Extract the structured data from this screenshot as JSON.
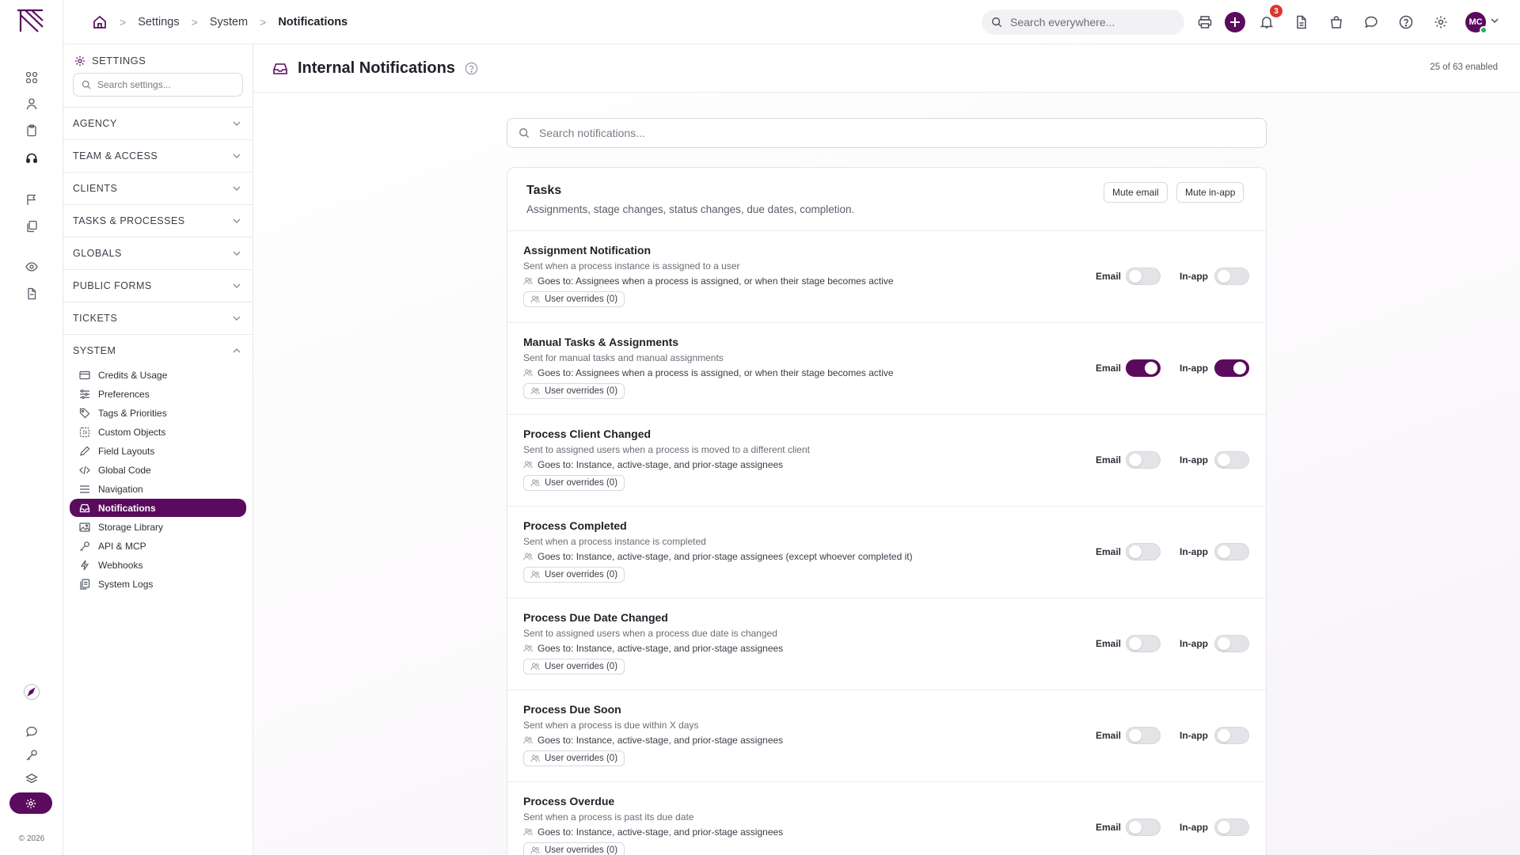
{
  "breadcrumb": {
    "items": [
      "Settings",
      "System"
    ],
    "current": "Notifications"
  },
  "global_search": {
    "placeholder": "Search everywhere..."
  },
  "notifications_badge": "3",
  "user": {
    "initials": "MC"
  },
  "footer": {
    "copyright": "© 2026"
  },
  "sidebar": {
    "heading": "SETTINGS",
    "search_placeholder": "Search settings...",
    "sections": [
      "AGENCY",
      "TEAM & ACCESS",
      "CLIENTS",
      "TASKS & PROCESSES",
      "GLOBALS",
      "PUBLIC FORMS",
      "TICKETS",
      "SYSTEM"
    ],
    "system_items": [
      {
        "label": "Credits & Usage",
        "icon": "card-icon"
      },
      {
        "label": "Preferences",
        "icon": "sliders-icon"
      },
      {
        "label": "Tags & Priorities",
        "icon": "tag-icon"
      },
      {
        "label": "Custom Objects",
        "icon": "objects-icon"
      },
      {
        "label": "Field Layouts",
        "icon": "pen-icon"
      },
      {
        "label": "Global Code",
        "icon": "code-icon"
      },
      {
        "label": "Navigation",
        "icon": "menu-icon"
      },
      {
        "label": "Notifications",
        "icon": "inbox-icon"
      },
      {
        "label": "Storage Library",
        "icon": "image-icon"
      },
      {
        "label": "API & MCP",
        "icon": "key-icon"
      },
      {
        "label": "Webhooks",
        "icon": "bolt-icon"
      },
      {
        "label": "System Logs",
        "icon": "logs-icon"
      }
    ],
    "active_item": "Notifications"
  },
  "page": {
    "title": "Internal Notifications",
    "enabled_count": "25 of 63 enabled"
  },
  "notif_search": {
    "placeholder": "Search notifications..."
  },
  "group": {
    "title": "Tasks",
    "subtitle": "Assignments, stage changes, status changes, due dates, completion.",
    "mute_email_label": "Mute email",
    "mute_inapp_label": "Mute in-app"
  },
  "labels": {
    "email": "Email",
    "inapp": "In-app",
    "user_overrides": "User overrides (0)"
  },
  "notifications": [
    {
      "title": "Assignment Notification",
      "desc": "Sent when a process instance is assigned to a user",
      "goes_to": "Goes to: Assignees when a process is assigned, or when their stage becomes active",
      "email": false,
      "inapp": false
    },
    {
      "title": "Manual Tasks & Assignments",
      "desc": "Sent for manual tasks and manual assignments",
      "goes_to": "Goes to: Assignees when a process is assigned, or when their stage becomes active",
      "email": true,
      "inapp": true
    },
    {
      "title": "Process Client Changed",
      "desc": "Sent to assigned users when a process is moved to a different client",
      "goes_to": "Goes to: Instance, active-stage, and prior-stage assignees",
      "email": false,
      "inapp": false
    },
    {
      "title": "Process Completed",
      "desc": "Sent when a process instance is completed",
      "goes_to": "Goes to: Instance, active-stage, and prior-stage assignees (except whoever completed it)",
      "email": false,
      "inapp": false
    },
    {
      "title": "Process Due Date Changed",
      "desc": "Sent to assigned users when a process due date is changed",
      "goes_to": "Goes to: Instance, active-stage, and prior-stage assignees",
      "email": false,
      "inapp": false
    },
    {
      "title": "Process Due Soon",
      "desc": "Sent when a process is due within X days",
      "goes_to": "Goes to: Instance, active-stage, and prior-stage assignees",
      "email": false,
      "inapp": false
    },
    {
      "title": "Process Overdue",
      "desc": "Sent when a process is past its due date",
      "goes_to": "Goes to: Instance, active-stage, and prior-stage assignees",
      "email": false,
      "inapp": false
    }
  ],
  "colors": {
    "accent": "#5b0b5e",
    "badge": "#e0342f",
    "online": "#1fb45a"
  }
}
